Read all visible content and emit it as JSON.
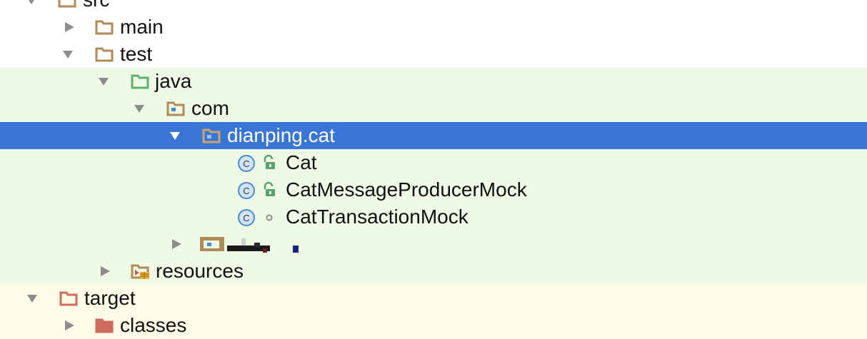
{
  "tree": {
    "items": [
      {
        "label": "src",
        "state": "expanded",
        "icon": "folder-icon"
      },
      {
        "label": "main",
        "state": "collapsed",
        "icon": "folder-icon"
      },
      {
        "label": "test",
        "state": "expanded",
        "icon": "folder-icon"
      },
      {
        "label": "java",
        "state": "expanded",
        "icon": "test-source-root-icon"
      },
      {
        "label": "com",
        "state": "expanded",
        "icon": "package-icon"
      },
      {
        "label": "dianping.cat",
        "state": "expanded",
        "selected": true,
        "icon": "package-icon"
      },
      {
        "label": "Cat",
        "icon": "class-icon",
        "access": "public-access-icon"
      },
      {
        "label": "CatMessageProducerMock",
        "icon": "class-icon",
        "access": "public-access-icon"
      },
      {
        "label": "CatTransactionMock",
        "icon": "class-icon",
        "access": "package-private-access-icon"
      },
      {
        "label": "",
        "state": "collapsed",
        "icon": "package-icon",
        "redacted": true
      },
      {
        "label": "resources",
        "state": "collapsed",
        "icon": "resources-folder-icon"
      },
      {
        "label": "target",
        "state": "expanded",
        "icon": "excluded-folder-icon"
      },
      {
        "label": "classes",
        "state": "collapsed",
        "icon": "excluded-folder-icon"
      }
    ]
  },
  "colors": {
    "selection": "#3875d6",
    "test_bg": "#eef9e6",
    "excluded_bg": "#fefbe7",
    "folder": "#b08a57",
    "test_folder": "#5fb26a",
    "excluded_folder": "#cf6a5e",
    "class_fill": "#cfe4f7",
    "class_stroke": "#4a8ad0",
    "lock": "#5aa36a"
  }
}
